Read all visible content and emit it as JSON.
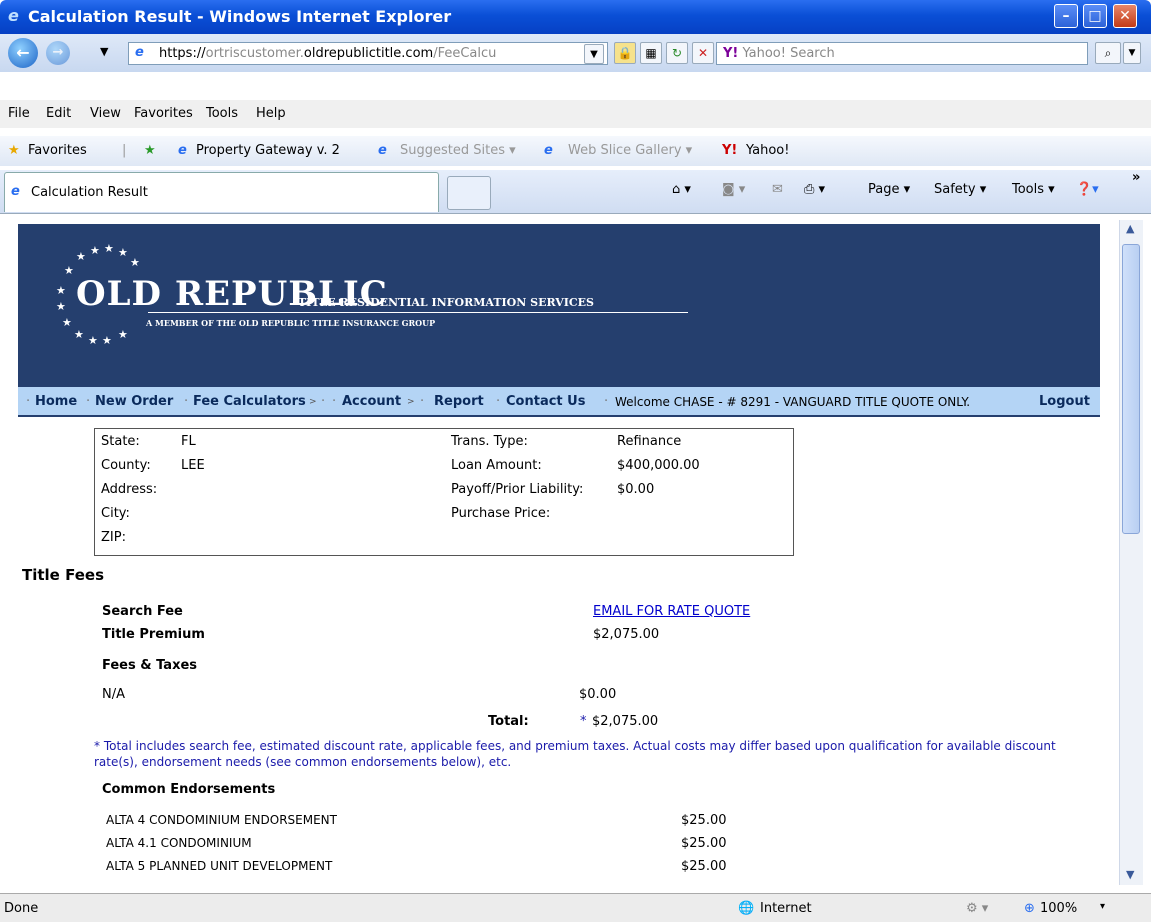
{
  "window": {
    "title": "Calculation Result - Windows Internet Explorer"
  },
  "addressbar": {
    "url_prefix": "https://",
    "url_sub": "ortriscustomer.",
    "url_domain": "oldrepublictitle.com",
    "url_path": "/FeeCalcu",
    "search_placeholder": "Yahoo! Search"
  },
  "menu": {
    "items": [
      "File",
      "Edit",
      "View",
      "Favorites",
      "Tools",
      "Help"
    ]
  },
  "favorites": {
    "label": "Favorites",
    "items": [
      "Property Gateway v. 2",
      "Suggested Sites ▾",
      "Web Slice Gallery ▾",
      "Yahoo!"
    ]
  },
  "tab": {
    "label": "Calculation Result"
  },
  "commandbar": {
    "page": "Page ▾",
    "safety": "Safety ▾",
    "tools": "Tools ▾"
  },
  "banner": {
    "logo": "OLD REPUBLIC",
    "subtitle": "TITLE RESIDENTIAL INFORMATION SERVICES",
    "member": "A MEMBER OF THE OLD REPUBLIC TITLE INSURANCE GROUP"
  },
  "nav": {
    "home": "Home",
    "new_order": "New Order",
    "fee_calculators": "Fee Calculators",
    "account": "Account",
    "report": "Report",
    "contact": "Contact Us",
    "welcome": "Welcome CHASE - # 8291 - VANGUARD TITLE QUOTE ONLY.",
    "logout": "Logout"
  },
  "info": {
    "state_label": "State:",
    "state": "FL",
    "county_label": "County:",
    "county": "LEE",
    "address_label": "Address:",
    "city_label": "City:",
    "zip_label": "ZIP:",
    "trans_label": "Trans. Type:",
    "trans": "Refinance",
    "loan_label": "Loan Amount:",
    "loan": "$400,000.00",
    "payoff_label": "Payoff/Prior Liability:",
    "payoff": "$0.00",
    "purchase_label": "Purchase Price:"
  },
  "fees": {
    "heading": "Title Fees",
    "search_fee_label": "Search Fee",
    "search_fee_value": "EMAIL FOR RATE QUOTE",
    "premium_label": "Title Premium",
    "premium_value": "$2,075.00",
    "taxes_label": "Fees & Taxes",
    "na_label": "N/A",
    "na_value": "$0.00",
    "total_label": "Total:",
    "total_star": "*",
    "total_value": "$2,075.00",
    "footnote": "* Total includes search fee, estimated discount rate, applicable fees, and premium taxes. Actual costs may differ based upon qualification for available discount rate(s), endorsement needs (see common endorsements below), etc."
  },
  "endorsements": {
    "heading": "Common Endorsements",
    "rows": [
      {
        "name": "ALTA 4 CONDOMINIUM ENDORSEMENT",
        "value": "$25.00"
      },
      {
        "name": "ALTA 4.1 CONDOMINIUM",
        "value": "$25.00"
      },
      {
        "name": "ALTA 5 PLANNED UNIT DEVELOPMENT",
        "value": "$25.00"
      }
    ]
  },
  "status": {
    "left": "Done",
    "zone": "Internet",
    "zoom": "100%"
  }
}
